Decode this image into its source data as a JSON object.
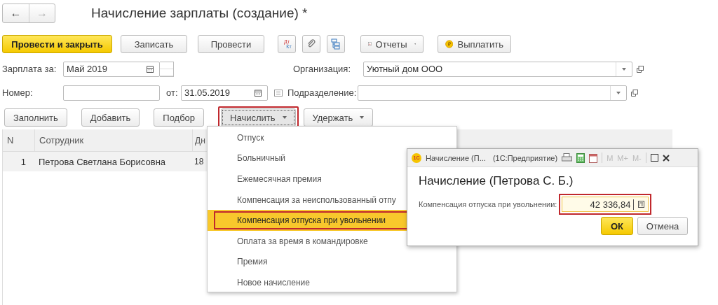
{
  "nav": {
    "back": "←",
    "forward": "→"
  },
  "title": "Начисление зарплаты (создание) *",
  "toolbar": [
    {
      "kind": "primary",
      "label": "Провести и закрыть"
    },
    {
      "kind": "button",
      "label": "Записать"
    },
    {
      "kind": "button",
      "label": "Провести"
    },
    {
      "kind": "dtkt",
      "lines": [
        "Дт",
        "Кт"
      ]
    },
    {
      "kind": "attach"
    },
    {
      "kind": "structure"
    },
    {
      "kind": "reports",
      "label": "Отчеты"
    },
    {
      "kind": "pay",
      "label": "Выплатить"
    }
  ],
  "salary_period": {
    "label": "Зарплата за:",
    "value": "Май 2019"
  },
  "organization": {
    "label": "Организация:",
    "value": "Уютный дом ООО"
  },
  "number": {
    "label": "Номер:"
  },
  "date": {
    "label": "от:",
    "value": "31.05.2019"
  },
  "subdivision": {
    "label": "Подразделение:"
  },
  "table_buttons": [
    {
      "label": "Заполнить",
      "dropdown": false,
      "annotated": false
    },
    {
      "label": "Добавить",
      "dropdown": false,
      "annotated": false
    },
    {
      "label": "Подбор",
      "dropdown": false,
      "annotated": false
    },
    {
      "label": "Начислить",
      "dropdown": true,
      "annotated": true
    },
    {
      "label": "Удержать",
      "dropdown": true,
      "annotated": false
    }
  ],
  "table": {
    "columns": [
      "N",
      "Сотрудник",
      "Дн"
    ],
    "rows": [
      {
        "cells": [
          "1",
          "Петрова Светлана Борисовна",
          "18"
        ],
        "selected": true
      }
    ]
  },
  "menu": {
    "items": [
      {
        "label": "Отпуск",
        "selected": false
      },
      {
        "label": "Больничный",
        "selected": false
      },
      {
        "label": "Ежемесячная премия",
        "selected": false
      },
      {
        "label": "Компенсация за неиспользованный отпу",
        "selected": false
      },
      {
        "label": "Компенсация отпуска при увольнении",
        "selected": true
      },
      {
        "label": "Оплата за время в командировке",
        "selected": false
      },
      {
        "label": "Премия",
        "selected": false
      },
      {
        "label": "Новое начисление",
        "selected": false
      }
    ]
  },
  "dialog": {
    "title": "Начисление (П...",
    "app": "(1С:Предприятие)",
    "logo": "1С",
    "memory_buttons": [
      {
        "label": "M",
        "disabled": true
      },
      {
        "label": "M+",
        "disabled": true
      },
      {
        "label": "M-",
        "disabled": true
      }
    ],
    "heading": "Начисление (Петрова С. Б.)",
    "field": {
      "label": "Компенсация отпуска при увольнении:",
      "value": "42 336,84",
      "annotated": true
    },
    "buttons": [
      {
        "kind": "primary",
        "label": "ОК"
      },
      {
        "kind": "button",
        "label": "Отмена"
      }
    ]
  }
}
